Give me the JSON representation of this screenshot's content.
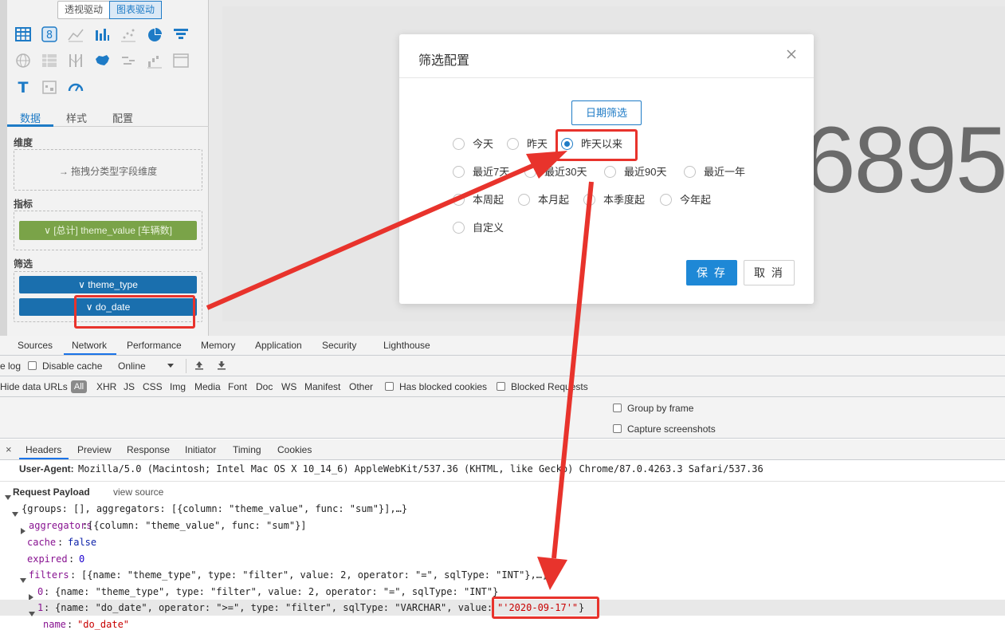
{
  "mode_toggle": {
    "pivot": "透视驱动",
    "chart": "图表驱动"
  },
  "panel_tabs": {
    "data": "数据",
    "style": "样式",
    "config": "配置"
  },
  "sections": {
    "dimension_label": "维度",
    "dimension_hint": "→ 拖拽分类型字段维度",
    "metric_label": "指标",
    "metric_pill": "∨ [总计] theme_value [车辆数]",
    "filter_label": "筛选",
    "filter_items": [
      "∨ theme_type",
      "∨ do_date"
    ]
  },
  "big_number": "6895",
  "modal": {
    "title": "筛选配置",
    "date_filter_button": "日期筛选",
    "options": [
      "今天",
      "昨天",
      "昨天以来",
      "最近7天",
      "最近30天",
      "最近90天",
      "最近一年",
      "本周起",
      "本月起",
      "本季度起",
      "今年起",
      "自定义"
    ],
    "selected": "昨天以来",
    "save": "保 存",
    "cancel": "取 消"
  },
  "devtools": {
    "tabs": [
      "Sources",
      "Network",
      "Performance",
      "Memory",
      "Application",
      "Security",
      "Lighthouse"
    ],
    "active_tab": "Network",
    "toolbar": {
      "preserve_log": "e log",
      "disable_cache": "Disable cache",
      "throttle": "Online"
    },
    "filterbar": {
      "hide_data_urls": "Hide data URLs",
      "all": "All",
      "types": [
        "XHR",
        "JS",
        "CSS",
        "Img",
        "Media",
        "Font",
        "Doc",
        "WS",
        "Manifest",
        "Other"
      ],
      "has_blocked_cookies": "Has blocked cookies",
      "blocked_requests": "Blocked Requests"
    },
    "options": {
      "group_by_frame": "Group by frame",
      "capture_screenshots": "Capture screenshots"
    },
    "subtabs": [
      "Headers",
      "Preview",
      "Response",
      "Initiator",
      "Timing",
      "Cookies"
    ],
    "active_subtab": "Headers",
    "close_symbol": "×",
    "user_agent_label": "User-Agent:",
    "user_agent_value": "Mozilla/5.0 (Macintosh; Intel Mac OS X 10_14_6) AppleWebKit/537.36 (KHTML, like Gecko) Chrome/87.0.4263.3 Safari/537.36",
    "payload_label": "Request Payload",
    "view_source": "view source",
    "payload": {
      "root": "{groups: [], aggregators: [{column: \"theme_value\", func: \"sum\"}],…}",
      "aggregators_key": "aggregators",
      "aggregators_val": "[{column: \"theme_value\", func: \"sum\"}]",
      "cache_key": "cache",
      "cache_val": "false",
      "expired_key": "expired",
      "expired_val": "0",
      "filters_key": "filters",
      "filters_val": "[{name: \"theme_type\", type: \"filter\", value: 2, operator: \"=\", sqlType: \"INT\"},…]",
      "f0_key": "0",
      "f0_val": "{name: \"theme_type\", type: \"filter\", value: 2, operator: \"=\", sqlType: \"INT\"}",
      "f1_key": "1",
      "f1_val": "{name: \"do_date\", operator: \">=\", type: \"filter\", sqlType: \"VARCHAR\", value: ",
      "f1_value": "\"'2020-09-17'\"",
      "f1_end": "}",
      "name_key": "name",
      "name_val": "\"do_date\""
    }
  },
  "colors": {
    "accent": "#1e7bc6",
    "annotation": "#e8332c",
    "metric": "#7aa348",
    "filter": "#1a6fae"
  }
}
